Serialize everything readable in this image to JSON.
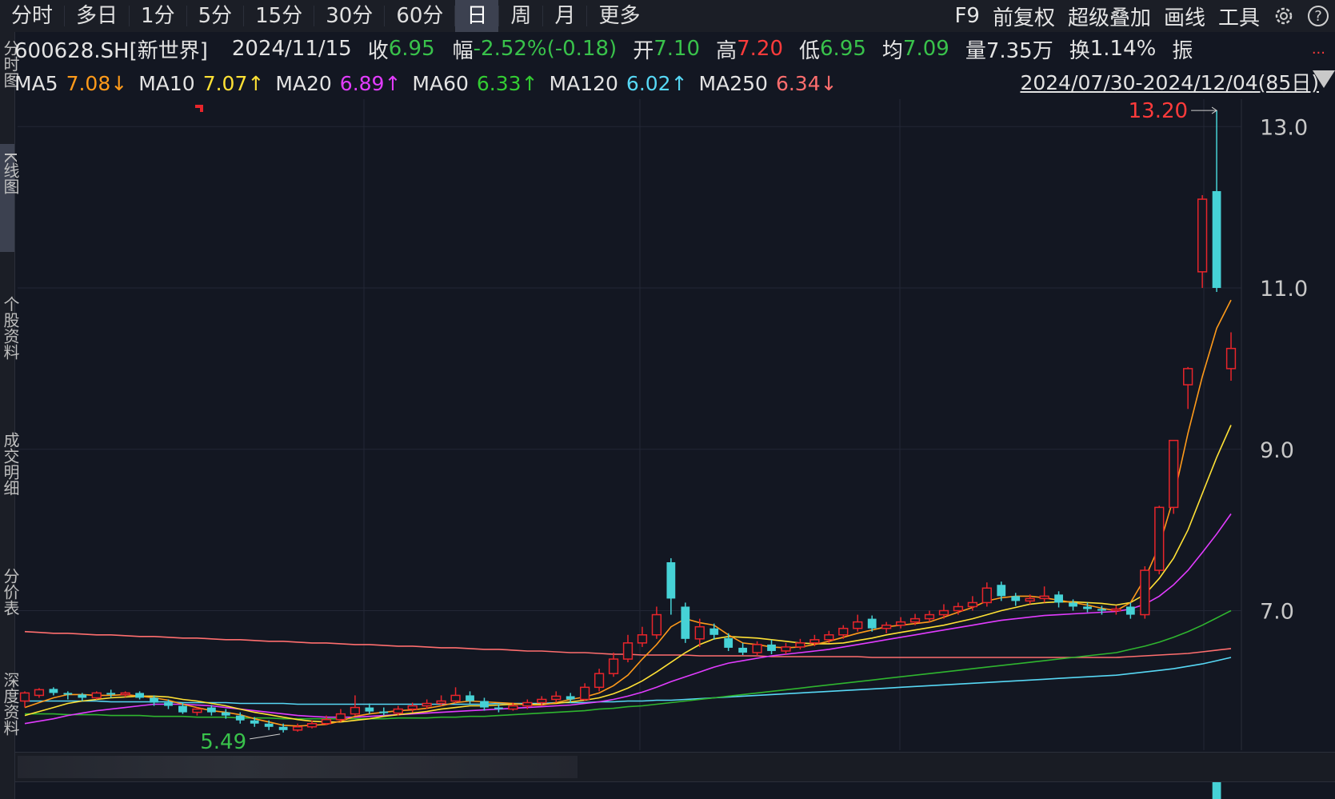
{
  "toolbar": {
    "tabs": [
      "分时",
      "多日",
      "1分",
      "5分",
      "15分",
      "30分",
      "60分",
      "日",
      "周",
      "月",
      "更多"
    ],
    "active_tab": "日",
    "right_tools": [
      "F9",
      "前复权",
      "超级叠加",
      "画线",
      "工具"
    ],
    "gear_icon": "gear-icon",
    "help_icon": "help-icon",
    "help_glyph": "?"
  },
  "quote": {
    "code": "600628.SH[新世界]",
    "date": "2024/11/15",
    "close_label": "收",
    "close": "6.95",
    "change_label": "幅",
    "change": "-2.52%(-0.18)",
    "open_label": "开",
    "open": "7.10",
    "high_label": "高",
    "high": "7.20",
    "low_label": "低",
    "low": "6.95",
    "avg_label": "均",
    "avg": "7.09",
    "volume_label": "量",
    "volume": "7.35万",
    "turnover_label": "换",
    "turnover": "1.14%",
    "amp_label": "振",
    "more": "..."
  },
  "ma": {
    "ma5_label": "MA5",
    "ma5": "7.08↓",
    "ma10_label": "MA10",
    "ma10": "7.07↑",
    "ma20_label": "MA20",
    "ma20": "6.89↑",
    "ma60_label": "MA60",
    "ma60": "6.33↑",
    "ma120_label": "MA120",
    "ma120": "6.02↑",
    "ma250_label": "MA250",
    "ma250": "6.34↓"
  },
  "date_range": "2024/07/30-2024/12/04(85日)",
  "sidebar_labels": [
    "分时图",
    "K线图",
    "个股资料",
    "成交明细",
    "分价表",
    "深度资料"
  ],
  "colors": {
    "up": "#e8252b",
    "down": "#46d2d6",
    "ma5": "#ff9a1a",
    "ma10": "#ffe135",
    "ma20": "#e23cff",
    "ma60": "#2fb52f",
    "ma120": "#57d8f5",
    "ma250": "#ff6e6e",
    "grid": "#232735",
    "axis_text": "#c8c8c8"
  },
  "chart_data": {
    "type": "candlestick",
    "ylim": [
      5.3,
      13.3
    ],
    "yticks": [
      "13.0",
      "11.0",
      "9.0",
      "7.0"
    ],
    "high_annotation": "13.20",
    "low_annotation": "5.49",
    "candles": [
      [
        5.88,
        5.98,
        6.0,
        5.8
      ],
      [
        5.95,
        6.02,
        6.04,
        5.92
      ],
      [
        6.03,
        5.98,
        6.05,
        5.95
      ],
      [
        5.98,
        5.96,
        6.0,
        5.9
      ],
      [
        5.96,
        5.92,
        5.98,
        5.88
      ],
      [
        5.92,
        5.98,
        6.0,
        5.9
      ],
      [
        5.98,
        5.96,
        6.02,
        5.92
      ],
      [
        5.96,
        5.98,
        6.0,
        5.93
      ],
      [
        5.98,
        5.92,
        6.0,
        5.9
      ],
      [
        5.92,
        5.86,
        5.95,
        5.82
      ],
      [
        5.86,
        5.82,
        5.9,
        5.78
      ],
      [
        5.82,
        5.74,
        5.86,
        5.72
      ],
      [
        5.74,
        5.78,
        5.8,
        5.7
      ],
      [
        5.8,
        5.74,
        5.83,
        5.7
      ],
      [
        5.74,
        5.7,
        5.78,
        5.66
      ],
      [
        5.7,
        5.64,
        5.74,
        5.6
      ],
      [
        5.64,
        5.6,
        5.68,
        5.56
      ],
      [
        5.6,
        5.56,
        5.64,
        5.52
      ],
      [
        5.56,
        5.52,
        5.6,
        5.49
      ],
      [
        5.52,
        5.56,
        5.6,
        5.5
      ],
      [
        5.56,
        5.6,
        5.64,
        5.54
      ],
      [
        5.6,
        5.65,
        5.7,
        5.58
      ],
      [
        5.65,
        5.72,
        5.78,
        5.62
      ],
      [
        5.72,
        5.8,
        5.95,
        5.7
      ],
      [
        5.8,
        5.75,
        5.85,
        5.72
      ],
      [
        5.75,
        5.73,
        5.8,
        5.7
      ],
      [
        5.73,
        5.78,
        5.82,
        5.7
      ],
      [
        5.78,
        5.82,
        5.86,
        5.74
      ],
      [
        5.82,
        5.85,
        5.9,
        5.78
      ],
      [
        5.85,
        5.88,
        5.95,
        5.82
      ],
      [
        5.88,
        5.95,
        6.05,
        5.85
      ],
      [
        5.95,
        5.88,
        6.0,
        5.84
      ],
      [
        5.88,
        5.8,
        5.92,
        5.76
      ],
      [
        5.8,
        5.78,
        5.84,
        5.74
      ],
      [
        5.78,
        5.82,
        5.86,
        5.76
      ],
      [
        5.82,
        5.86,
        5.9,
        5.78
      ],
      [
        5.86,
        5.9,
        5.94,
        5.82
      ],
      [
        5.9,
        5.94,
        6.0,
        5.86
      ],
      [
        5.94,
        5.9,
        5.98,
        5.86
      ],
      [
        5.9,
        6.05,
        6.1,
        5.88
      ],
      [
        6.05,
        6.22,
        6.28,
        6.0
      ],
      [
        6.22,
        6.4,
        6.48,
        6.18
      ],
      [
        6.4,
        6.6,
        6.7,
        6.36
      ],
      [
        6.6,
        6.7,
        6.8,
        6.55
      ],
      [
        6.7,
        6.95,
        7.05,
        6.65
      ],
      [
        7.6,
        7.15,
        7.65,
        6.95
      ],
      [
        7.05,
        6.65,
        7.1,
        6.6
      ],
      [
        6.65,
        6.8,
        6.9,
        6.55
      ],
      [
        6.78,
        6.7,
        6.84,
        6.64
      ],
      [
        6.66,
        6.54,
        6.72,
        6.5
      ],
      [
        6.54,
        6.48,
        6.6,
        6.45
      ],
      [
        6.48,
        6.58,
        6.62,
        6.44
      ],
      [
        6.58,
        6.5,
        6.64,
        6.46
      ],
      [
        6.5,
        6.55,
        6.6,
        6.46
      ],
      [
        6.55,
        6.6,
        6.65,
        6.52
      ],
      [
        6.6,
        6.64,
        6.7,
        6.56
      ],
      [
        6.64,
        6.7,
        6.75,
        6.6
      ],
      [
        6.7,
        6.78,
        6.82,
        6.65
      ],
      [
        6.78,
        6.86,
        6.95,
        6.74
      ],
      [
        6.9,
        6.78,
        6.94,
        6.74
      ],
      [
        6.78,
        6.82,
        6.86,
        6.72
      ],
      [
        6.82,
        6.86,
        6.92,
        6.78
      ],
      [
        6.86,
        6.9,
        6.96,
        6.82
      ],
      [
        6.9,
        6.95,
        7.0,
        6.86
      ],
      [
        6.95,
        7.0,
        7.08,
        6.9
      ],
      [
        7.0,
        7.05,
        7.1,
        6.95
      ],
      [
        7.05,
        7.1,
        7.18,
        7.0
      ],
      [
        7.1,
        7.28,
        7.35,
        7.05
      ],
      [
        7.32,
        7.18,
        7.36,
        7.12
      ],
      [
        7.18,
        7.12,
        7.22,
        7.06
      ],
      [
        7.12,
        7.15,
        7.2,
        7.08
      ],
      [
        7.15,
        7.18,
        7.3,
        7.1
      ],
      [
        7.2,
        7.1,
        7.24,
        7.04
      ],
      [
        7.1,
        7.05,
        7.14,
        7.0
      ],
      [
        7.05,
        7.02,
        7.1,
        6.98
      ],
      [
        7.02,
        7.0,
        7.06,
        6.95
      ],
      [
        7.0,
        7.02,
        7.06,
        6.95
      ],
      [
        7.05,
        6.95,
        7.1,
        6.9
      ],
      [
        6.95,
        7.5,
        7.55,
        6.9
      ],
      [
        7.5,
        8.28,
        8.3,
        7.45
      ],
      [
        8.28,
        9.11,
        9.11,
        8.2
      ],
      [
        9.8,
        10.0,
        10.02,
        9.5
      ],
      [
        11.2,
        12.1,
        12.15,
        11.0
      ],
      [
        12.2,
        11.0,
        13.2,
        10.95
      ],
      [
        10.0,
        10.25,
        10.45,
        9.85
      ]
    ],
    "ma5": [
      5.8,
      5.86,
      5.92,
      5.96,
      5.96,
      5.95,
      5.95,
      5.96,
      5.94,
      5.92,
      5.89,
      5.84,
      5.8,
      5.76,
      5.74,
      5.71,
      5.66,
      5.62,
      5.58,
      5.57,
      5.58,
      5.59,
      5.63,
      5.69,
      5.72,
      5.74,
      5.76,
      5.77,
      5.79,
      5.82,
      5.86,
      5.88,
      5.87,
      5.86,
      5.85,
      5.83,
      5.83,
      5.86,
      5.9,
      5.93,
      5.98,
      6.07,
      6.2,
      6.4,
      6.58,
      6.8,
      6.9,
      6.85,
      6.82,
      6.7,
      6.6,
      6.58,
      6.55,
      6.54,
      6.55,
      6.58,
      6.62,
      6.67,
      6.72,
      6.76,
      6.8,
      6.82,
      6.84,
      6.86,
      6.92,
      6.98,
      7.04,
      7.12,
      7.16,
      7.18,
      7.18,
      7.16,
      7.13,
      7.1,
      7.07,
      7.03,
      7.0,
      7.1,
      7.4,
      7.8,
      8.4,
      9.2,
      9.9,
      10.5,
      10.85
    ],
    "ma10": [
      5.7,
      5.75,
      5.8,
      5.85,
      5.88,
      5.9,
      5.92,
      5.93,
      5.94,
      5.94,
      5.93,
      5.9,
      5.88,
      5.85,
      5.82,
      5.78,
      5.74,
      5.71,
      5.68,
      5.65,
      5.63,
      5.62,
      5.62,
      5.64,
      5.66,
      5.69,
      5.71,
      5.73,
      5.75,
      5.78,
      5.8,
      5.82,
      5.82,
      5.83,
      5.84,
      5.84,
      5.84,
      5.85,
      5.87,
      5.89,
      5.92,
      5.97,
      6.04,
      6.13,
      6.24,
      6.36,
      6.48,
      6.58,
      6.65,
      6.68,
      6.67,
      6.66,
      6.64,
      6.62,
      6.6,
      6.59,
      6.59,
      6.6,
      6.63,
      6.66,
      6.7,
      6.73,
      6.76,
      6.79,
      6.82,
      6.86,
      6.9,
      6.95,
      7.0,
      7.04,
      7.08,
      7.1,
      7.11,
      7.11,
      7.1,
      7.09,
      7.07,
      7.1,
      7.2,
      7.4,
      7.65,
      8.0,
      8.45,
      8.9,
      9.3
    ],
    "ma20": [
      5.6,
      5.63,
      5.66,
      5.7,
      5.73,
      5.76,
      5.78,
      5.8,
      5.82,
      5.84,
      5.84,
      5.84,
      5.83,
      5.82,
      5.8,
      5.78,
      5.76,
      5.74,
      5.72,
      5.7,
      5.69,
      5.68,
      5.68,
      5.68,
      5.69,
      5.7,
      5.71,
      5.72,
      5.73,
      5.74,
      5.75,
      5.76,
      5.77,
      5.78,
      5.79,
      5.8,
      5.81,
      5.82,
      5.83,
      5.85,
      5.87,
      5.9,
      5.94,
      5.99,
      6.05,
      6.12,
      6.18,
      6.24,
      6.3,
      6.35,
      6.38,
      6.41,
      6.44,
      6.46,
      6.48,
      6.5,
      6.52,
      6.55,
      6.58,
      6.61,
      6.64,
      6.67,
      6.7,
      6.73,
      6.76,
      6.79,
      6.82,
      6.85,
      6.88,
      6.9,
      6.92,
      6.94,
      6.95,
      6.96,
      6.97,
      6.98,
      6.99,
      7.02,
      7.08,
      7.18,
      7.32,
      7.5,
      7.72,
      7.95,
      8.2
    ],
    "ma60": [
      5.72,
      5.72,
      5.72,
      5.71,
      5.71,
      5.71,
      5.7,
      5.7,
      5.7,
      5.69,
      5.69,
      5.69,
      5.68,
      5.68,
      5.68,
      5.67,
      5.67,
      5.67,
      5.66,
      5.66,
      5.66,
      5.66,
      5.66,
      5.66,
      5.66,
      5.66,
      5.67,
      5.67,
      5.67,
      5.68,
      5.68,
      5.69,
      5.69,
      5.7,
      5.71,
      5.72,
      5.73,
      5.74,
      5.75,
      5.76,
      5.78,
      5.79,
      5.81,
      5.82,
      5.84,
      5.86,
      5.88,
      5.9,
      5.92,
      5.94,
      5.96,
      5.98,
      6.0,
      6.02,
      6.04,
      6.06,
      6.08,
      6.1,
      6.12,
      6.14,
      6.16,
      6.18,
      6.2,
      6.22,
      6.24,
      6.26,
      6.28,
      6.3,
      6.32,
      6.34,
      6.36,
      6.38,
      6.4,
      6.42,
      6.44,
      6.46,
      6.48,
      6.52,
      6.56,
      6.61,
      6.67,
      6.74,
      6.82,
      6.91,
      7.0
    ],
    "ma120": [
      5.88,
      5.88,
      5.88,
      5.88,
      5.88,
      5.88,
      5.87,
      5.87,
      5.87,
      5.87,
      5.87,
      5.86,
      5.86,
      5.86,
      5.86,
      5.85,
      5.85,
      5.85,
      5.85,
      5.84,
      5.84,
      5.84,
      5.84,
      5.84,
      5.84,
      5.84,
      5.84,
      5.84,
      5.84,
      5.84,
      5.84,
      5.84,
      5.84,
      5.85,
      5.85,
      5.85,
      5.85,
      5.86,
      5.86,
      5.86,
      5.87,
      5.87,
      5.88,
      5.88,
      5.89,
      5.89,
      5.9,
      5.91,
      5.92,
      5.93,
      5.94,
      5.95,
      5.96,
      5.97,
      5.98,
      5.99,
      6.0,
      6.01,
      6.02,
      6.03,
      6.04,
      6.05,
      6.06,
      6.07,
      6.08,
      6.09,
      6.1,
      6.11,
      6.12,
      6.13,
      6.14,
      6.15,
      6.16,
      6.17,
      6.18,
      6.19,
      6.2,
      6.22,
      6.24,
      6.26,
      6.28,
      6.31,
      6.34,
      6.38,
      6.42
    ],
    "ma250": [
      6.74,
      6.73,
      6.72,
      6.72,
      6.71,
      6.7,
      6.7,
      6.69,
      6.68,
      6.68,
      6.67,
      6.66,
      6.66,
      6.65,
      6.64,
      6.64,
      6.63,
      6.62,
      6.62,
      6.61,
      6.6,
      6.6,
      6.59,
      6.58,
      6.58,
      6.57,
      6.56,
      6.56,
      6.55,
      6.54,
      6.54,
      6.53,
      6.52,
      6.52,
      6.51,
      6.5,
      6.5,
      6.49,
      6.48,
      6.48,
      6.47,
      6.46,
      6.46,
      6.45,
      6.45,
      6.45,
      6.45,
      6.44,
      6.44,
      6.44,
      6.44,
      6.44,
      6.43,
      6.43,
      6.43,
      6.43,
      6.43,
      6.43,
      6.43,
      6.42,
      6.42,
      6.42,
      6.42,
      6.42,
      6.42,
      6.42,
      6.42,
      6.42,
      6.42,
      6.42,
      6.42,
      6.42,
      6.42,
      6.42,
      6.42,
      6.42,
      6.42,
      6.43,
      6.44,
      6.45,
      6.46,
      6.47,
      6.49,
      6.51,
      6.53
    ]
  }
}
